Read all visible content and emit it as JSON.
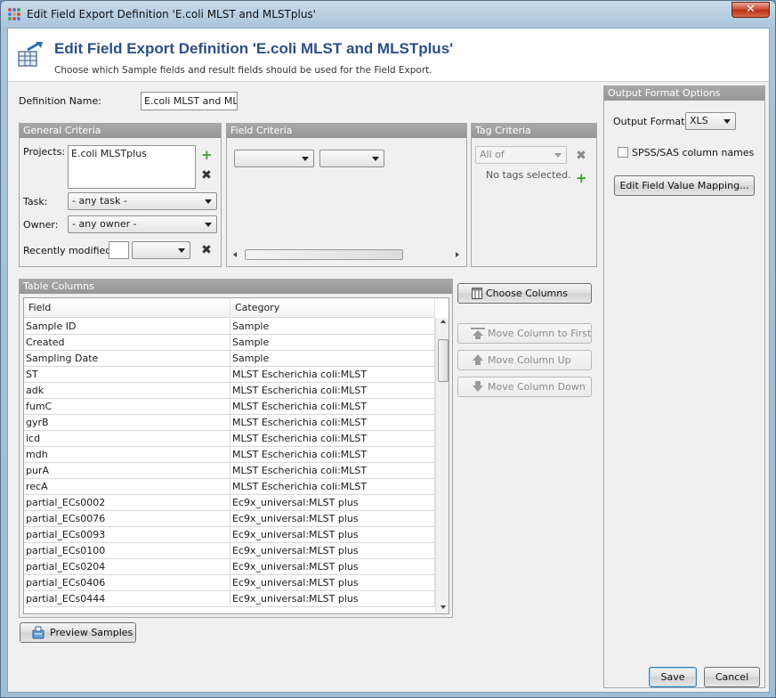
{
  "window": {
    "title": "Edit Field Export Definition 'E.coli MLST and MLSTplus'",
    "close_glyph": "✕"
  },
  "header": {
    "title": "Edit Field Export Definition 'E.coli MLST and MLSTplus'",
    "subtitle": "Choose which Sample fields and result fields should be used for the Field Export."
  },
  "definition": {
    "label": "Definition Name:",
    "value": "E.coli MLST and MLSTplus"
  },
  "general_criteria": {
    "title": "General Criteria",
    "projects_label": "Projects:",
    "projects": [
      "E.coli MLSTplus"
    ],
    "task_label": "Task:",
    "task_value": "- any task -",
    "owner_label": "Owner:",
    "owner_value": "- any owner -",
    "recent_label": "Recently modified:",
    "recent_value": ""
  },
  "field_criteria": {
    "title": "Field Criteria",
    "field_value": "",
    "operator_value": ""
  },
  "tag_criteria": {
    "title": "Tag Criteria",
    "mode_value": "All of",
    "empty_text": "No tags selected."
  },
  "output": {
    "title": "Output Format Options",
    "format_label": "Output Format:",
    "format_value": "XLS",
    "spss_label": "SPSS/SAS column names",
    "spss_checked": false,
    "mapping_button": "Edit Field Value Mapping..."
  },
  "table_columns": {
    "title": "Table Columns",
    "headers": [
      "Field",
      "Category"
    ],
    "rows": [
      [
        "Sample ID",
        "Sample"
      ],
      [
        "Created",
        "Sample"
      ],
      [
        "Sampling Date",
        "Sample"
      ],
      [
        "ST",
        "MLST Escherichia coli:MLST"
      ],
      [
        "adk",
        "MLST Escherichia coli:MLST"
      ],
      [
        "fumC",
        "MLST Escherichia coli:MLST"
      ],
      [
        "gyrB",
        "MLST Escherichia coli:MLST"
      ],
      [
        "icd",
        "MLST Escherichia coli:MLST"
      ],
      [
        "mdh",
        "MLST Escherichia coli:MLST"
      ],
      [
        "purA",
        "MLST Escherichia coli:MLST"
      ],
      [
        "recA",
        "MLST Escherichia coli:MLST"
      ],
      [
        "partial_ECs0002",
        "Ec9x_universal:MLST plus"
      ],
      [
        "partial_ECs0076",
        "Ec9x_universal:MLST plus"
      ],
      [
        "partial_ECs0093",
        "Ec9x_universal:MLST plus"
      ],
      [
        "partial_ECs0100",
        "Ec9x_universal:MLST plus"
      ],
      [
        "partial_ECs0204",
        "Ec9x_universal:MLST plus"
      ],
      [
        "partial_ECs0406",
        "Ec9x_universal:MLST plus"
      ],
      [
        "partial_ECs0444",
        "Ec9x_universal:MLST plus"
      ]
    ]
  },
  "buttons": {
    "choose_columns": "Choose Columns",
    "move_first": "Move Column to First",
    "move_up": "Move Column Up",
    "move_down": "Move Column Down",
    "preview": "Preview Samples",
    "save": "Save",
    "cancel": "Cancel"
  },
  "colors": {
    "header_title": "#2d4f86",
    "panel_head": "#a0a0a0",
    "plus_green": "#3aa02a"
  }
}
